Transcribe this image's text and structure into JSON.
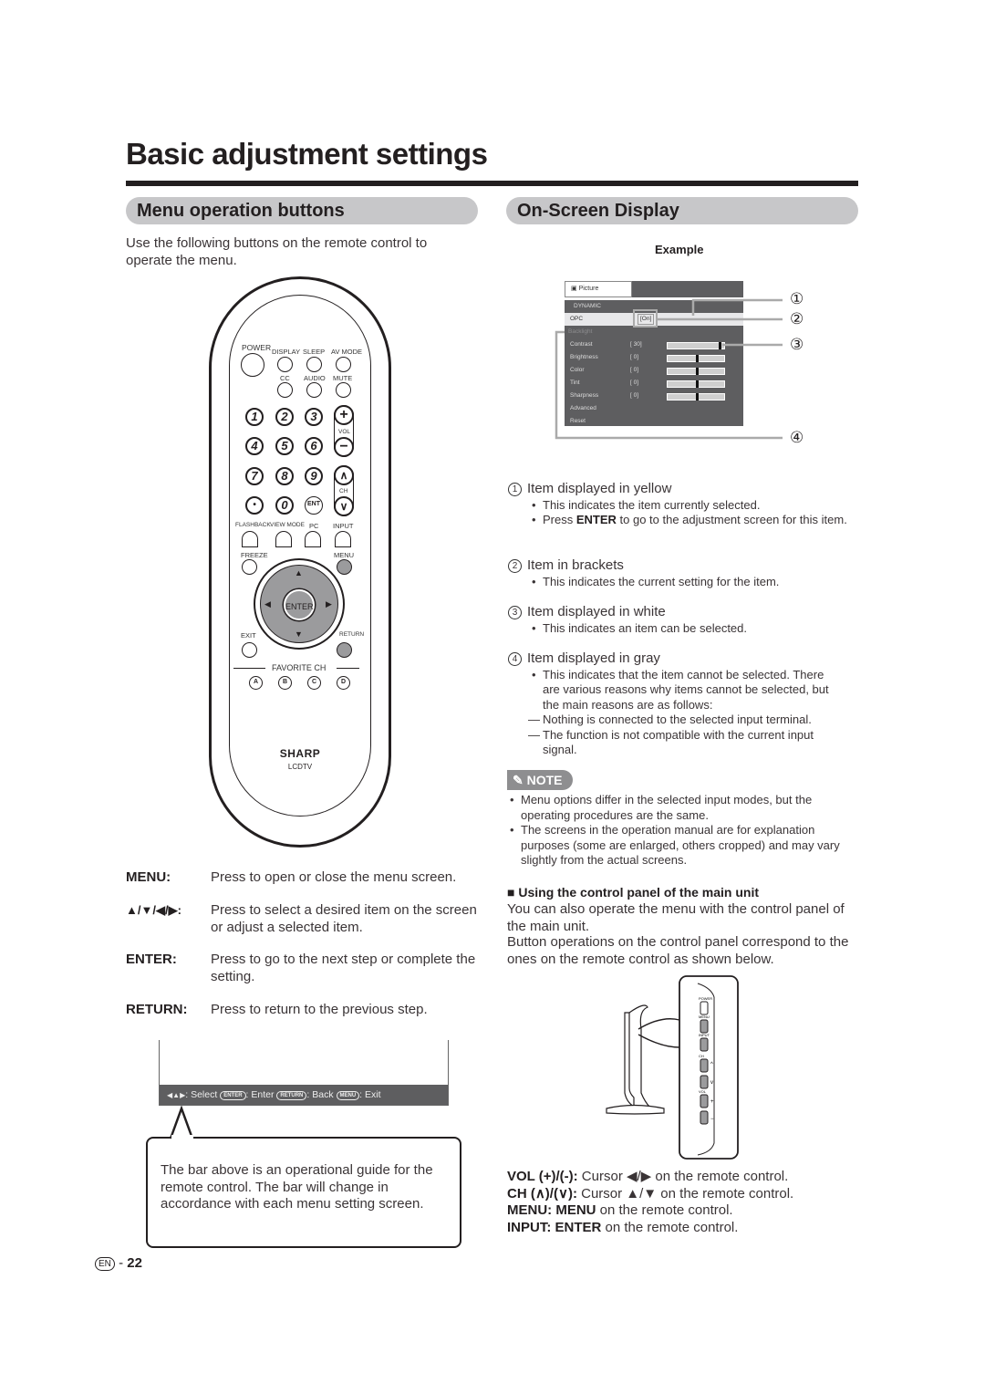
{
  "page": {
    "title": "Basic adjustment settings",
    "page_number": "22",
    "lang_badge": "EN"
  },
  "left": {
    "heading": "Menu operation buttons",
    "intro": "Use the following buttons on the remote control to operate the menu.",
    "remote": {
      "top_labels": [
        "POWER",
        "DISPLAY",
        "SLEEP",
        "AV MODE"
      ],
      "second_labels": [
        "CC",
        "AUDIO",
        "MUTE"
      ],
      "numbers": [
        "1",
        "2",
        "3",
        "4",
        "5",
        "6",
        "7",
        "8",
        "9",
        "•",
        "0",
        "ENT"
      ],
      "vol_label": "VOL",
      "ch_label": "CH",
      "vol_plus": "+",
      "vol_minus": "−",
      "ch_up": "∧",
      "ch_down": "∨",
      "row_labels": [
        "FLASHBACK",
        "VIEW MODE",
        "PC",
        "INPUT"
      ],
      "freeze": "FREEZE",
      "menu": "MENU",
      "exit": "EXIT",
      "return": "RETURN",
      "enter": "ENTER",
      "favorite": "FAVORITE CH",
      "fav_buttons": [
        "A",
        "B",
        "C",
        "D"
      ],
      "brand": "SHARP",
      "model": "LCDTV"
    },
    "definitions": [
      {
        "key": "MENU:",
        "value": "Press to open or close the menu screen."
      },
      {
        "key": "▲/▼/◀/▶:",
        "value": "Press to select a desired item on the screen or adjust a selected item."
      },
      {
        "key": "ENTER:",
        "value": "Press to go to the next step or complete the setting."
      },
      {
        "key": "RETURN:",
        "value": "Press to return to the previous step."
      }
    ],
    "guide_bar": {
      "arrows": "◀▲▶",
      "select": ": Select",
      "enter_pill": "ENTER",
      "enter": ": Enter",
      "return_pill": "RETURN",
      "back": ": Back",
      "menu_pill": "MENU",
      "exit": ": Exit"
    },
    "callout": "The bar above is an operational guide for the remote control. The bar will change in accordance with each menu setting screen."
  },
  "right": {
    "heading": "On-Screen Display",
    "example_label": "Example",
    "osd": {
      "tab": "Picture",
      "mode": "DYNAMIC",
      "rows": [
        {
          "label": "OPC",
          "value": "[On]",
          "state": "selected"
        },
        {
          "label": "Backlight",
          "value": "",
          "state": "gray"
        },
        {
          "label": "Contrast",
          "value": "[      30]",
          "slider": 0.9,
          "state": "white"
        },
        {
          "label": "Brightness",
          "value": "[        0]",
          "slider": 0.5,
          "state": "white"
        },
        {
          "label": "Color",
          "value": "[        0]",
          "slider": 0.5,
          "state": "white"
        },
        {
          "label": "Tint",
          "value": "[        0]",
          "slider": 0.5,
          "state": "white"
        },
        {
          "label": "Sharpness",
          "value": "[        0]",
          "slider": 0.5,
          "state": "white"
        },
        {
          "label": "Advanced",
          "value": "",
          "state": "white"
        },
        {
          "label": "Reset",
          "value": "",
          "state": "white"
        }
      ],
      "callouts": [
        "①",
        "②",
        "③",
        "④"
      ]
    },
    "items": [
      {
        "num": "1",
        "title": "Item displayed in yellow",
        "bullets": [
          "This indicates the item currently selected.",
          "Press ENTER to go to the adjustment screen for this item."
        ]
      },
      {
        "num": "2",
        "title": "Item in brackets",
        "bullets": [
          "This indicates the current setting for the item."
        ]
      },
      {
        "num": "3",
        "title": "Item displayed in white",
        "bullets": [
          "This indicates an item can be selected."
        ]
      },
      {
        "num": "4",
        "title": "Item displayed in gray",
        "bullets": [
          "This indicates that the item cannot be selected. There are various reasons why items cannot be selected, but the main reasons are as follows:"
        ],
        "dashes": [
          "Nothing is connected to the selected input terminal.",
          "The function is not compatible with the current input signal."
        ]
      }
    ],
    "item1_bullet2_pre": "Press ",
    "item1_bullet2_bold": "ENTER",
    "item1_bullet2_post": " to go to the adjustment screen for this item.",
    "note_label": "NOTE",
    "notes": [
      "Menu options differ in the selected input modes, but the operating procedures are the same.",
      "The screens in the operation manual are for explanation purposes (some are enlarged, others cropped) and may vary slightly from the actual screens."
    ],
    "control_panel": {
      "heading": "Using the control panel of the main unit",
      "p1": "You can also operate the menu with the control panel of the main unit.",
      "p2": "Button operations on the control panel correspond to the ones on the remote control as shown below.",
      "panel_labels": [
        "POWER",
        "MENU",
        "INPUT",
        "CH",
        "VOL"
      ],
      "mappings": [
        {
          "key": "VOL (+)/(-):",
          "text": " Cursor ◀/▶ on the remote control."
        },
        {
          "key": "CH (∧)/(∨):",
          "text": " Cursor ▲/▼ on the remote control."
        },
        {
          "key": "MENU: MENU",
          "text": " on the remote control."
        },
        {
          "key": "INPUT: ENTER",
          "text": " on the remote control."
        }
      ]
    }
  }
}
